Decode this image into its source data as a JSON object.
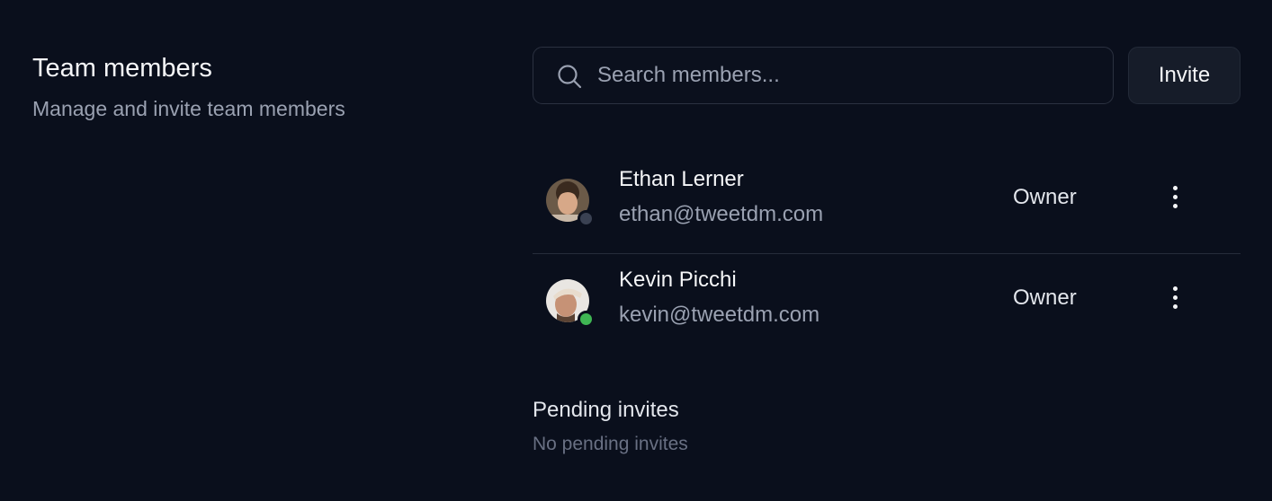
{
  "section": {
    "title": "Team members",
    "subtitle": "Manage and invite team members"
  },
  "search": {
    "placeholder": "Search members...",
    "value": "",
    "icon": "search-icon"
  },
  "invite_button": {
    "label": "Invite"
  },
  "members": [
    {
      "name": "Ethan Lerner",
      "email": "ethan@tweetdm.com",
      "role": "Owner",
      "status": "offline",
      "status_color": "#3a4152"
    },
    {
      "name": "Kevin Picchi",
      "email": "kevin@tweetdm.com",
      "role": "Owner",
      "status": "online",
      "status_color": "#3fb653"
    }
  ],
  "pending": {
    "title": "Pending invites",
    "empty_text": "No pending invites"
  },
  "colors": {
    "background": "#0a0f1c",
    "border": "#2b3140",
    "text_primary": "#f5f6f8",
    "text_muted": "#9aa1b1"
  }
}
